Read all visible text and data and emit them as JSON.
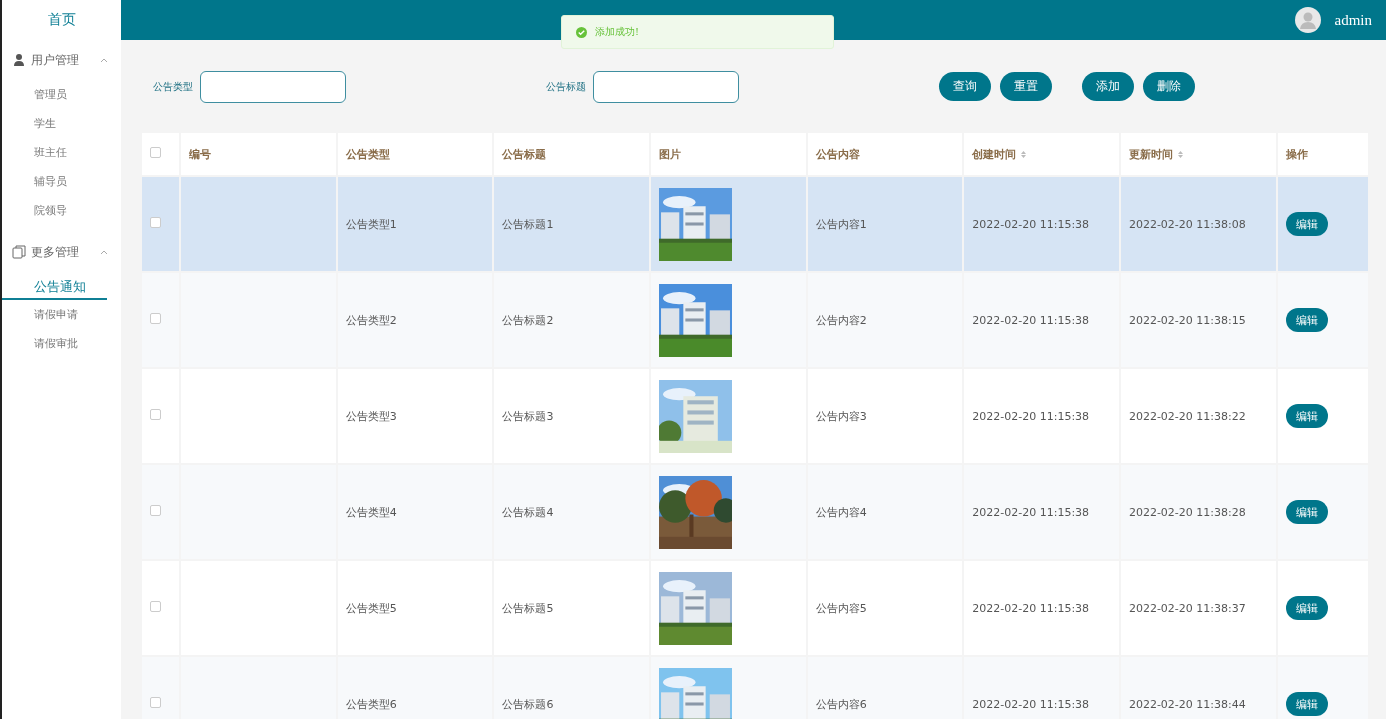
{
  "sidebar": {
    "home": "首页",
    "groups": [
      {
        "label": "用户管理",
        "expanded": true,
        "items": [
          {
            "label": "管理员",
            "selected": false
          },
          {
            "label": "学生",
            "selected": false
          },
          {
            "label": "班主任",
            "selected": false
          },
          {
            "label": "辅导员",
            "selected": false
          },
          {
            "label": "院领导",
            "selected": false
          }
        ]
      },
      {
        "label": "更多管理",
        "expanded": true,
        "items": [
          {
            "label": "公告通知",
            "selected": true
          },
          {
            "label": "请假申请",
            "selected": false
          },
          {
            "label": "请假审批",
            "selected": false
          }
        ]
      }
    ]
  },
  "header": {
    "user": "admin"
  },
  "toast": {
    "message": "添加成功!"
  },
  "filters": [
    {
      "label": "公告类型"
    },
    {
      "label": "公告标题"
    }
  ],
  "buttons": [
    "查询",
    "重置",
    "添加",
    "删除"
  ],
  "table": {
    "all_checked": false,
    "columns": [
      {
        "label": "编号",
        "sortable": false
      },
      {
        "label": "公告类型",
        "sortable": false
      },
      {
        "label": "公告标题",
        "sortable": false
      },
      {
        "label": "图片",
        "sortable": false
      },
      {
        "label": "公告内容",
        "sortable": false
      },
      {
        "label": "创建时间",
        "sortable": true
      },
      {
        "label": "更新时间",
        "sortable": true
      },
      {
        "label": "操作",
        "sortable": false
      }
    ],
    "rows": [
      {
        "checked": false,
        "highlighted": true,
        "type": "公告类型1",
        "title": "公告标题1",
        "content": "公告内容1",
        "created": "2022-02-20 11:15:38",
        "updated": "2022-02-20 11:38:08",
        "action": "编辑"
      },
      {
        "checked": false,
        "highlighted": false,
        "type": "公告类型2",
        "title": "公告标题2",
        "content": "公告内容2",
        "created": "2022-02-20 11:15:38",
        "updated": "2022-02-20 11:38:15",
        "action": "编辑"
      },
      {
        "checked": false,
        "highlighted": false,
        "type": "公告类型3",
        "title": "公告标题3",
        "content": "公告内容3",
        "created": "2022-02-20 11:15:38",
        "updated": "2022-02-20 11:38:22",
        "action": "编辑"
      },
      {
        "checked": false,
        "highlighted": false,
        "type": "公告类型4",
        "title": "公告标题4",
        "content": "公告内容4",
        "created": "2022-02-20 11:15:38",
        "updated": "2022-02-20 11:38:28",
        "action": "编辑"
      },
      {
        "checked": false,
        "highlighted": false,
        "type": "公告类型5",
        "title": "公告标题5",
        "content": "公告内容5",
        "created": "2022-02-20 11:15:38",
        "updated": "2022-02-20 11:38:37",
        "action": "编辑"
      },
      {
        "checked": false,
        "highlighted": false,
        "type": "公告类型6",
        "title": "公告标题6",
        "content": "公告内容6",
        "created": "2022-02-20 11:15:38",
        "updated": "2022-02-20 11:38:44",
        "action": "编辑"
      }
    ]
  }
}
